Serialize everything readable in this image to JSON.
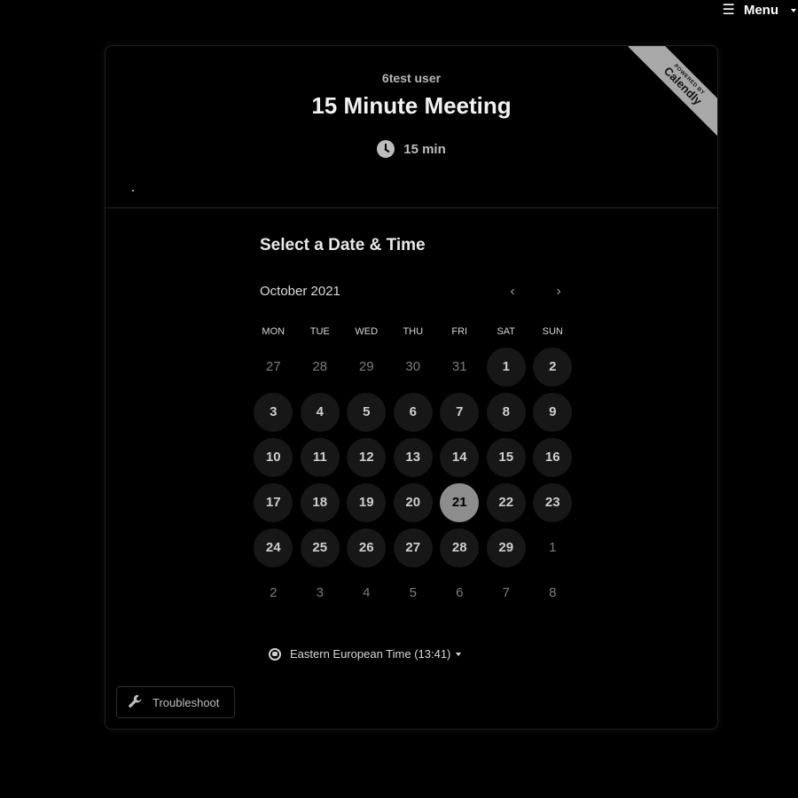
{
  "top_menu": {
    "icon": "hamburger-icon",
    "label": "Menu"
  },
  "event": {
    "owner": "6test user",
    "title": "15 Minute Meeting",
    "duration": "15 min",
    "powered_by": "POWERED BY",
    "brand": "Calendly"
  },
  "picker": {
    "heading": "Select a Date & Time",
    "month": "October 2021",
    "weekdays": [
      "MON",
      "TUE",
      "WED",
      "THU",
      "FRI",
      "SAT",
      "SUN"
    ],
    "days": [
      {
        "n": "27",
        "s": "other"
      },
      {
        "n": "28",
        "s": "other"
      },
      {
        "n": "29",
        "s": "other"
      },
      {
        "n": "30",
        "s": "other"
      },
      {
        "n": "31",
        "s": "other"
      },
      {
        "n": "1",
        "s": "available"
      },
      {
        "n": "2",
        "s": "available"
      },
      {
        "n": "3",
        "s": "available"
      },
      {
        "n": "4",
        "s": "available"
      },
      {
        "n": "5",
        "s": "available"
      },
      {
        "n": "6",
        "s": "available"
      },
      {
        "n": "7",
        "s": "available"
      },
      {
        "n": "8",
        "s": "available"
      },
      {
        "n": "9",
        "s": "available"
      },
      {
        "n": "10",
        "s": "available"
      },
      {
        "n": "11",
        "s": "available"
      },
      {
        "n": "12",
        "s": "available"
      },
      {
        "n": "13",
        "s": "available"
      },
      {
        "n": "14",
        "s": "available"
      },
      {
        "n": "15",
        "s": "available"
      },
      {
        "n": "16",
        "s": "available"
      },
      {
        "n": "17",
        "s": "available"
      },
      {
        "n": "18",
        "s": "available"
      },
      {
        "n": "19",
        "s": "available"
      },
      {
        "n": "20",
        "s": "available"
      },
      {
        "n": "21",
        "s": "selected"
      },
      {
        "n": "22",
        "s": "available"
      },
      {
        "n": "23",
        "s": "available"
      },
      {
        "n": "24",
        "s": "available"
      },
      {
        "n": "25",
        "s": "available"
      },
      {
        "n": "26",
        "s": "available"
      },
      {
        "n": "27",
        "s": "available"
      },
      {
        "n": "28",
        "s": "available"
      },
      {
        "n": "29",
        "s": "available"
      },
      {
        "n": "1",
        "s": "other"
      },
      {
        "n": "2",
        "s": "other"
      },
      {
        "n": "3",
        "s": "other"
      },
      {
        "n": "4",
        "s": "other"
      },
      {
        "n": "5",
        "s": "other"
      },
      {
        "n": "6",
        "s": "other"
      },
      {
        "n": "7",
        "s": "other"
      },
      {
        "n": "8",
        "s": "other"
      }
    ],
    "timezone": "Eastern European Time (13:41)"
  },
  "troubleshoot": {
    "label": "Troubleshoot",
    "icon": "wrench-icon"
  },
  "colors": {
    "background": "#000000",
    "available_day": "#171717",
    "selected_day": "#8d8d8d",
    "ribbon": "#a8a8a8"
  }
}
